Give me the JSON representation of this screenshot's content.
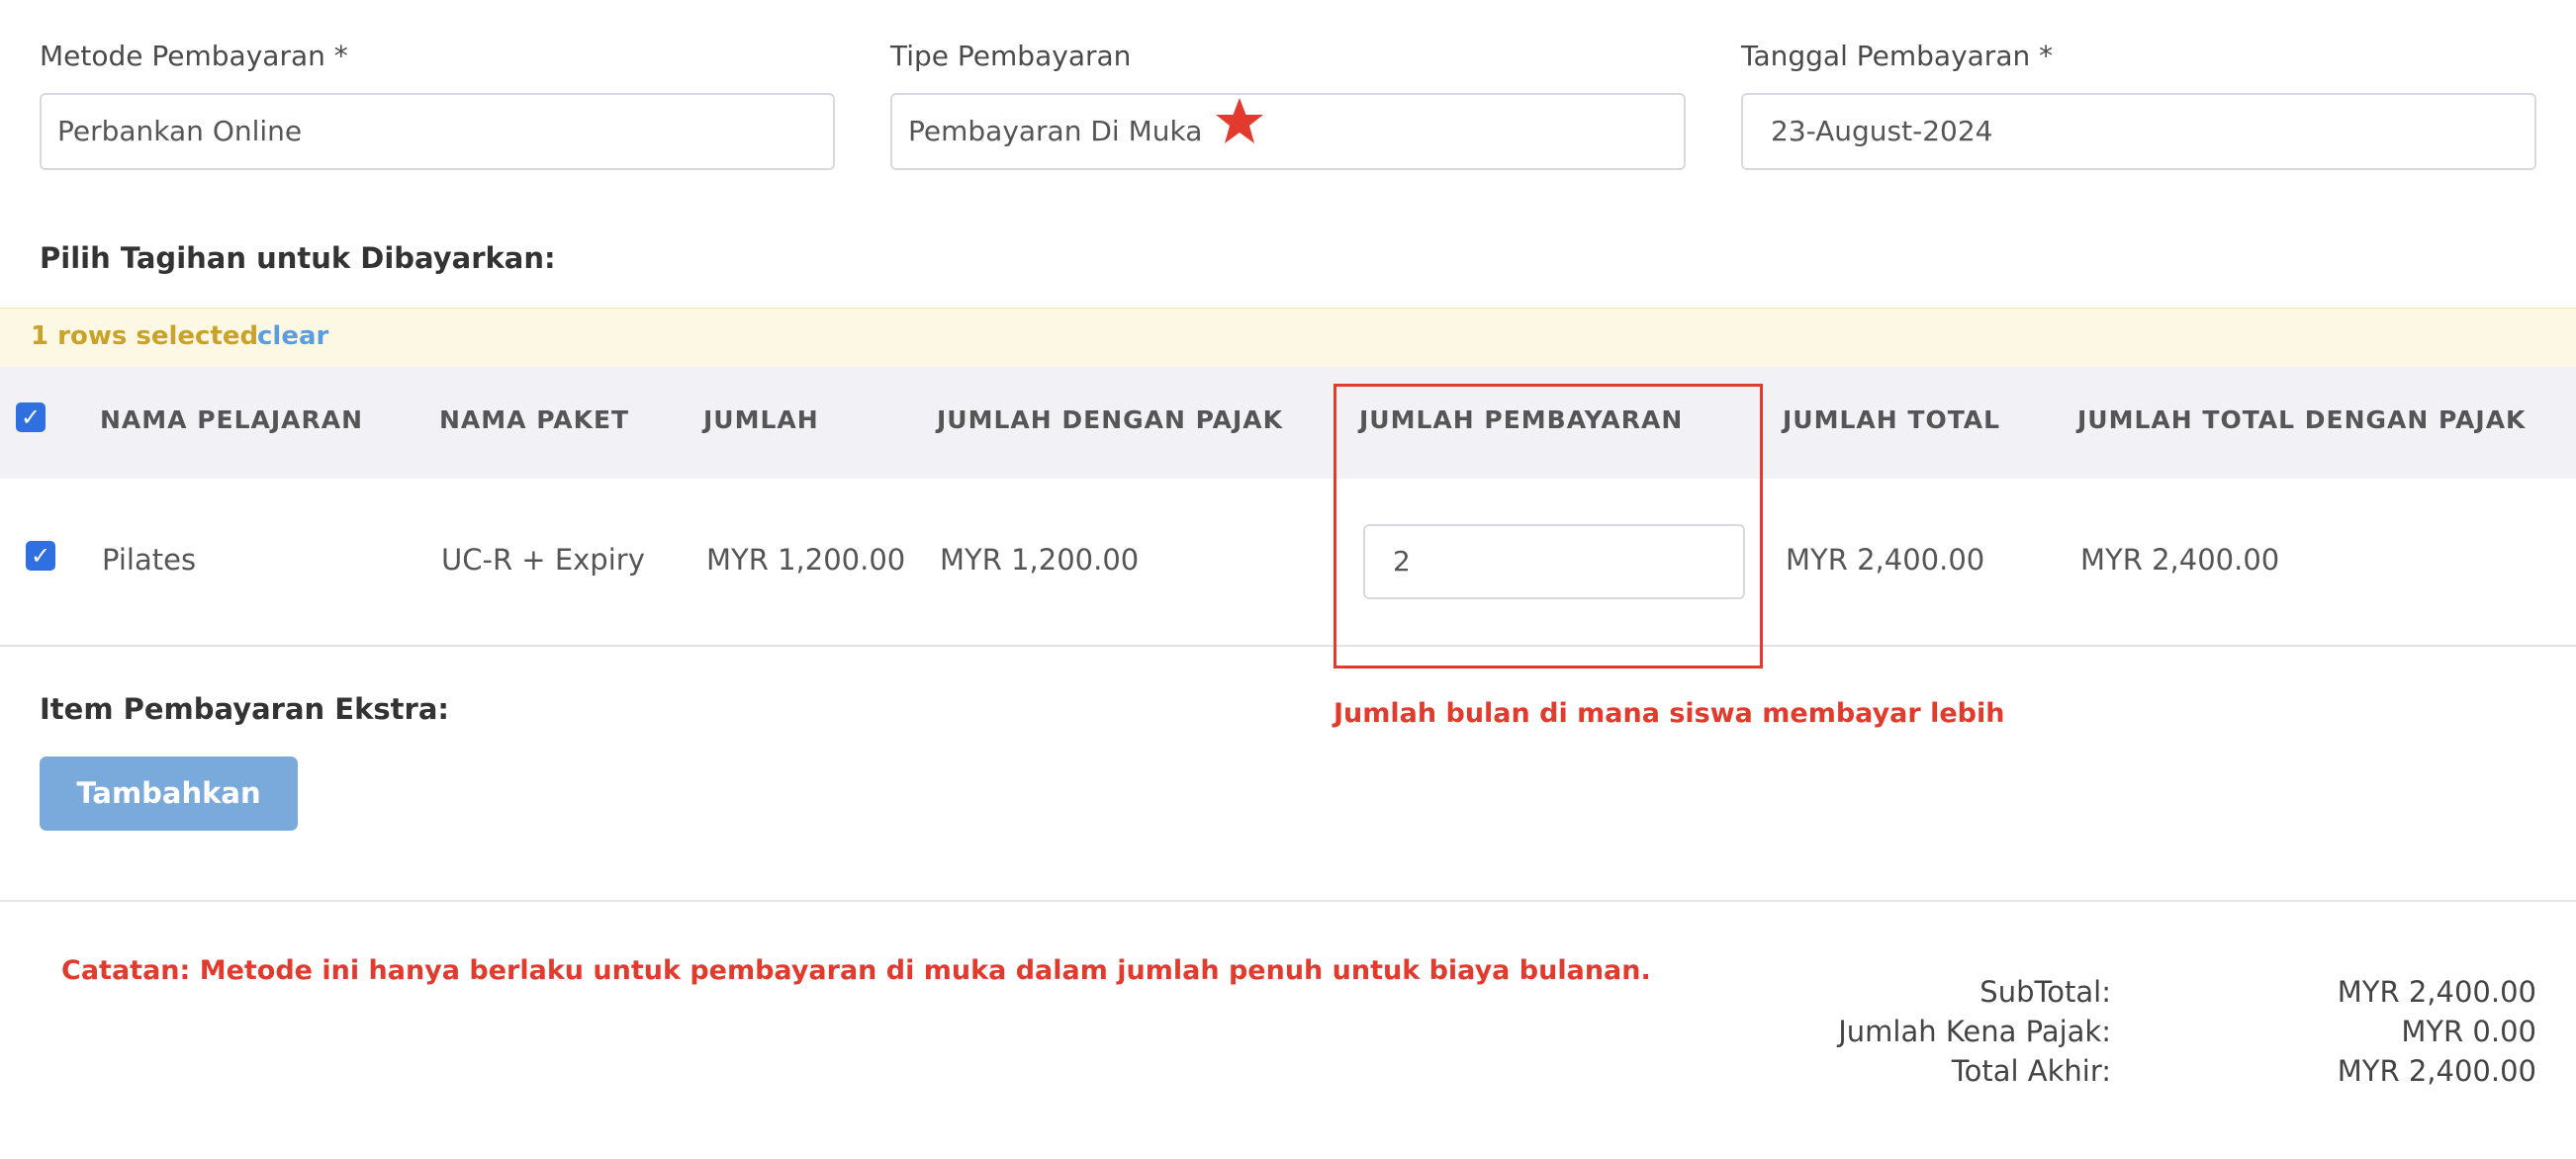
{
  "form": {
    "method_label": "Metode Pembayaran *",
    "method_value": "Perbankan Online",
    "type_label": "Tipe Pembayaran",
    "type_value": "Pembayaran Di Muka",
    "date_label": "Tanggal Pembayaran *",
    "date_value": "23-August-2024"
  },
  "section_title": "Pilih Tagihan untuk Dibayarkan:",
  "selection": {
    "count_text": "1 rows selected",
    "clear_label": "clear"
  },
  "table": {
    "columns": [
      "NAMA PELAJARAN",
      "NAMA PAKET",
      "JUMLAH",
      "JUMLAH DENGAN PAJAK",
      "JUMLAH PEMBAYARAN",
      "JUMLAH TOTAL",
      "JUMLAH TOTAL DENGAN PAJAK"
    ],
    "rows": [
      {
        "lesson": "Pilates",
        "package": "UC-R + Expiry",
        "amount": "MYR 1,200.00",
        "amount_tax": "MYR 1,200.00",
        "payment_count": "2",
        "total": "MYR 2,400.00",
        "total_tax": "MYR 2,400.00"
      }
    ]
  },
  "annotation": "Jumlah bulan di mana siswa membayar lebih",
  "extra": {
    "title": "Item Pembayaran Ekstra:",
    "add_label": "Tambahkan"
  },
  "note": "Catatan: Metode ini hanya berlaku untuk pembayaran di muka dalam jumlah penuh untuk biaya bulanan.",
  "summary": {
    "subtotal_label": "SubTotal:",
    "subtotal_value": "MYR 2,400.00",
    "taxable_label": "Jumlah Kena Pajak:",
    "taxable_value": "MYR 0.00",
    "final_label": "Total Akhir:",
    "final_value": "MYR 2,400.00"
  },
  "colors": {
    "accent_red": "#e23b2e",
    "button_blue": "#7aa9dc",
    "selection_text": "#c9a227",
    "clear_link": "#5a9ee0",
    "checkbox_blue": "#2f6fe0"
  },
  "icons": {
    "star": "star-icon",
    "check": "checkbox-checked-icon"
  }
}
